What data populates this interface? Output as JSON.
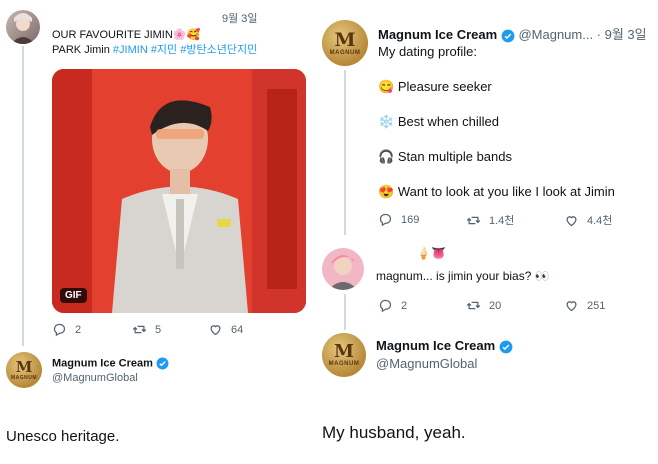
{
  "left_tweet": {
    "date": "9월 3일",
    "text_line1": "OUR FAVOURITE JIMIN🌸🥰",
    "text_plain": "PARK Jimin ",
    "hashtags": "#JIMIN #지민 #방탄소년단지민",
    "gif_badge": "GIF",
    "replies": "2",
    "retweets": "5",
    "likes": "64"
  },
  "left_reply": {
    "name": "Magnum Ice Cream",
    "handle": "@MagnumGlobal",
    "caption": "Unesco heritage."
  },
  "right_tweet": {
    "name": "Magnum Ice Cream",
    "handle_date": "@Magnum... · 9월 3일",
    "intro": "My dating profile:",
    "lines": [
      {
        "emoji": "😋",
        "text": "Pleasure seeker"
      },
      {
        "emoji": "❄️",
        "text": "Best when chilled"
      },
      {
        "emoji": "🎧",
        "text": "Stan multiple bands"
      },
      {
        "emoji": "😍",
        "text": "Want to look at you like I look at Jimin"
      }
    ],
    "replies": "169",
    "retweets": "1.4천",
    "likes": "4.4천"
  },
  "right_reply_tweet": {
    "emoji_row": "🍦👅",
    "text": "magnum... is jimin your bias? 👀",
    "replies": "2",
    "retweets": "20",
    "likes": "251"
  },
  "right_reply": {
    "name": "Magnum Ice Cream",
    "handle": "@MagnumGlobal",
    "caption": "My husband, yeah."
  },
  "logo": {
    "letter": "M",
    "word": "MAGNUM"
  },
  "colors": {
    "link": "#1d9bf0",
    "verified": "#1d9bf0",
    "gif_bg": "#e8372b"
  }
}
